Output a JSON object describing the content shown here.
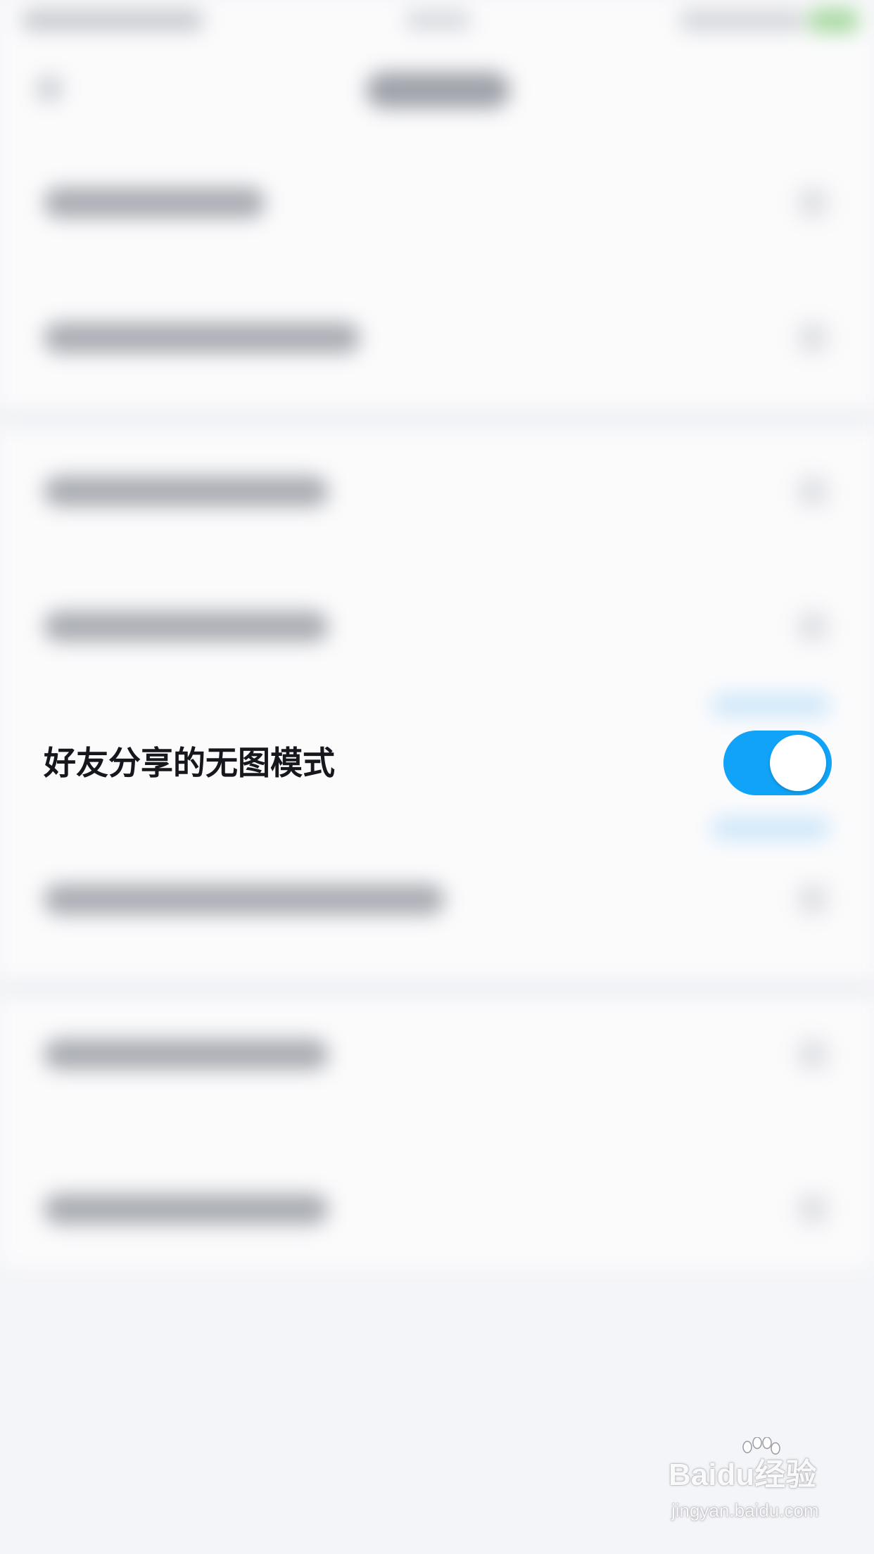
{
  "settings": {
    "focused_item": {
      "label": "好友分享的无图模式",
      "enabled": true
    }
  },
  "colors": {
    "toggle_on": "#11a3f7",
    "label_text": "#16171c",
    "background": "#f4f5f8"
  },
  "watermark": {
    "logo_text": "Baidu经验",
    "url_text": "jingyan.baidu.com"
  }
}
